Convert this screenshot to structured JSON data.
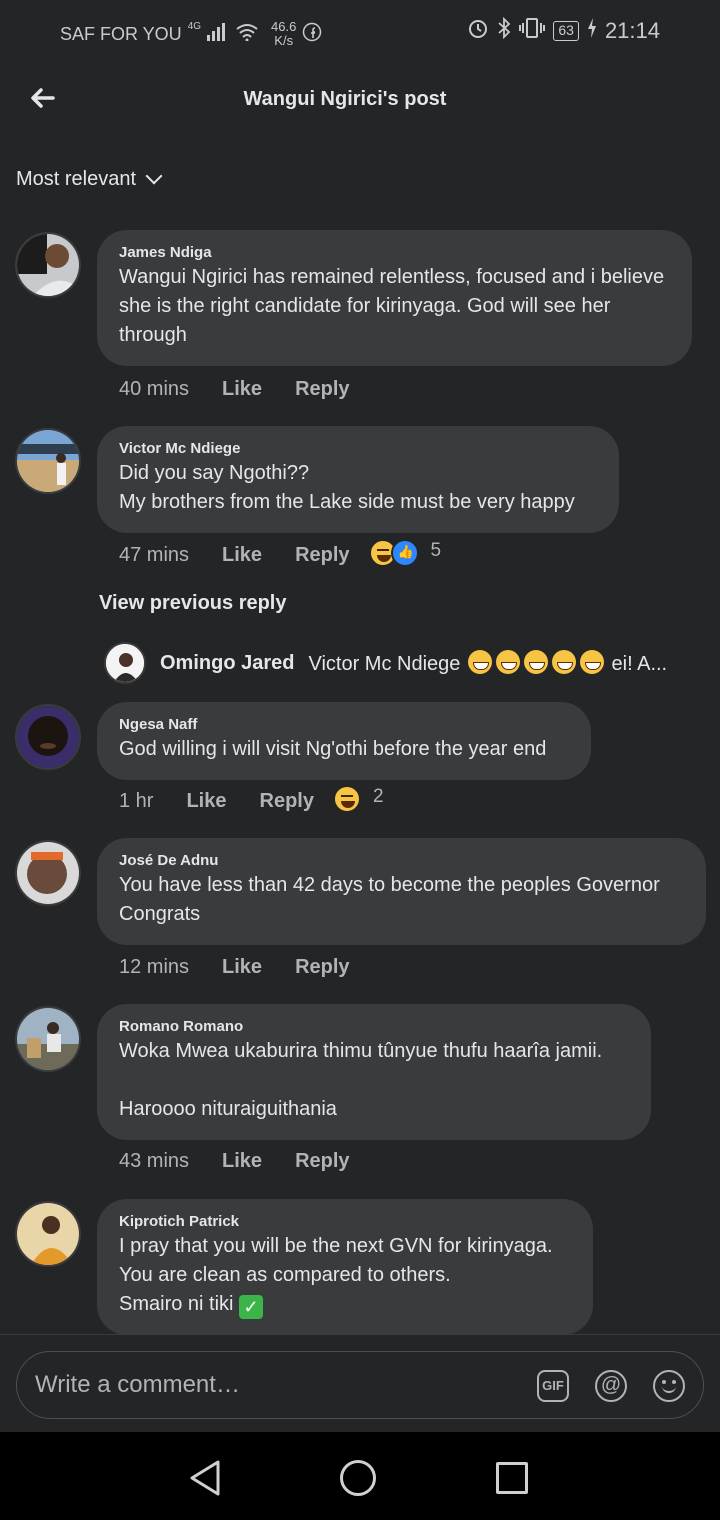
{
  "status_bar": {
    "carrier": "SAF FOR YOU",
    "network": "4G",
    "speed_value": "46.6",
    "speed_unit": "K/s",
    "battery": "63",
    "time": "21:14"
  },
  "header": {
    "title": "Wangui Ngirici's post"
  },
  "sort": {
    "label": "Most relevant"
  },
  "actions": {
    "like": "Like",
    "reply": "Reply"
  },
  "comments": [
    {
      "author": "James Ndiga",
      "text": "Wangui Ngirici has remained relentless, focused and i believe she is the right candidate for kirinyaga. God will see her through",
      "time": "40 mins"
    },
    {
      "author": "Victor Mc Ndiege",
      "text": "Did you say Ngothi??\nMy brothers from the Lake side must be very happy",
      "time": "47 mins",
      "reaction_count": "5"
    },
    {
      "author": "Ngesa Naff",
      "text": "God willing i will visit Ng'othi before the year end",
      "time": "1 hr",
      "reaction_count": "2"
    },
    {
      "author": "José De Adnu",
      "text": "You have less than 42 days to become the peoples Governor Congrats",
      "time": "12 mins"
    },
    {
      "author": "Romano Romano",
      "text": "Woka Mwea ukaburira thimu tûnyue thufu haarîa jamii.\n\nHaroooo nituraiguithania",
      "time": "43 mins"
    },
    {
      "author": "Kiprotich Patrick",
      "text": "I pray that you will be the next GVN for kirinyaga.\nYou are clean as compared to others.\nSmairo ni tiki",
      "time": ""
    }
  ],
  "view_previous": "View previous reply",
  "reply_preview": {
    "author": "Omingo Jared",
    "mention": "Victor Mc Ndiege",
    "suffix": "ei! A..."
  },
  "composer": {
    "placeholder": "Write a comment…",
    "gif_label": "GIF",
    "at_label": "@"
  }
}
